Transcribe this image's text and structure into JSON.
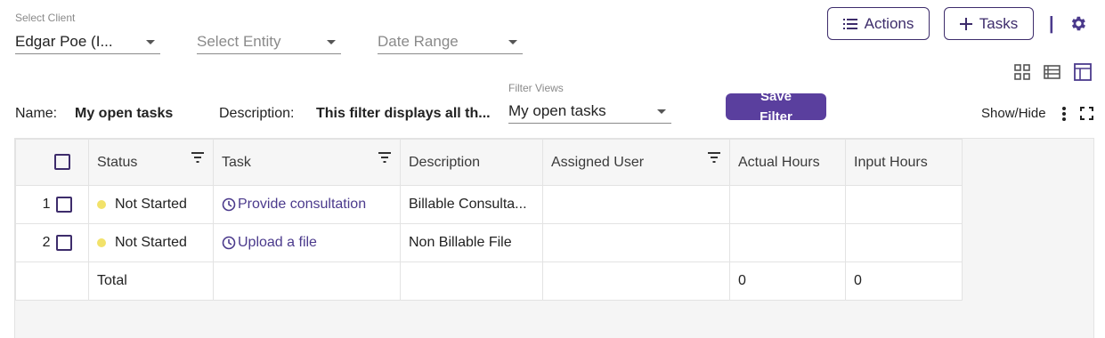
{
  "filters": {
    "client": {
      "label": "Select Client",
      "value": "Edgar Poe (I..."
    },
    "entity": {
      "placeholder": "Select Entity"
    },
    "date_range": {
      "placeholder": "Date Range"
    }
  },
  "toolbar": {
    "actions_label": "Actions",
    "tasks_label": "Tasks",
    "separator": "|"
  },
  "filter_info": {
    "name_label": "Name:",
    "name_value": "My open tasks",
    "description_label": "Description:",
    "description_value": "This filter displays all th...",
    "views_label": "Filter Views",
    "views_value": "My open tasks",
    "save_label_line1": "Save",
    "save_label_line2": "Filter",
    "show_hide_label": "Show/Hide"
  },
  "table": {
    "columns": [
      "Status",
      "Task",
      "Description",
      "Assigned User",
      "Actual Hours",
      "Input Hours"
    ],
    "rows": [
      {
        "num": "1",
        "status": "Not Started",
        "task": "Provide consultation",
        "description": "Billable Consulta...",
        "assigned_user": "",
        "actual_hours": "",
        "input_hours": ""
      },
      {
        "num": "2",
        "status": "Not Started",
        "task": "Upload a file",
        "description": "Non Billable File",
        "assigned_user": "",
        "actual_hours": "",
        "input_hours": ""
      }
    ],
    "total": {
      "label": "Total",
      "actual_hours": "0",
      "input_hours": "0"
    }
  },
  "colors": {
    "accent": "#4b3a8c",
    "button": "#5a3f9e",
    "status_not_started": "#f2e26a"
  }
}
